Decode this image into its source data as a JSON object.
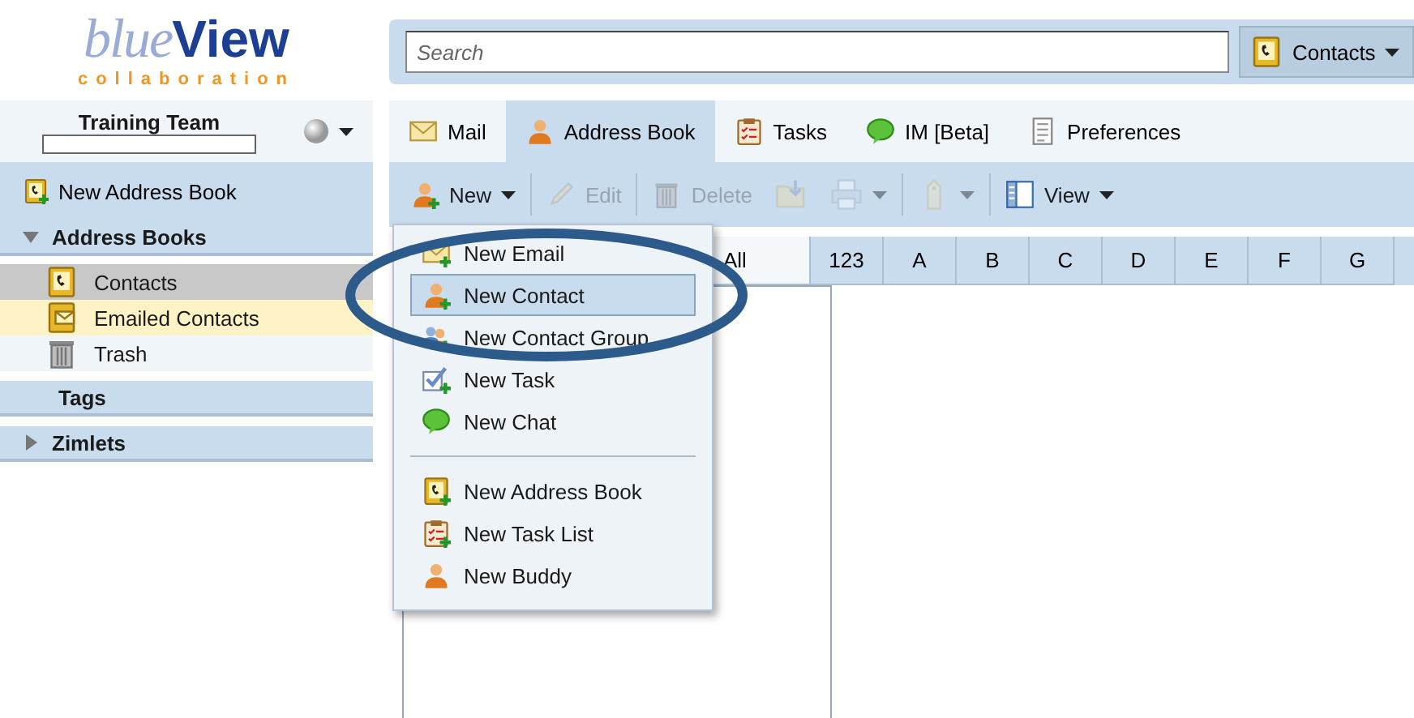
{
  "logo": {
    "word_light": "blue",
    "word_bold": "View",
    "tagline": "collaboration"
  },
  "search": {
    "placeholder": "Search"
  },
  "search_scope": {
    "label": "Contacts"
  },
  "user": {
    "name": "Training Team"
  },
  "sidebar": {
    "new_button": "New Address Book",
    "sections": [
      {
        "title": "Address Books",
        "kind": "collapsible",
        "expanded": true,
        "items": [
          {
            "label": "Contacts",
            "selected": true,
            "hovered": false
          },
          {
            "label": "Emailed Contacts",
            "selected": false,
            "hovered": true
          },
          {
            "label": "Trash",
            "selected": false,
            "hovered": false
          }
        ]
      },
      {
        "title": "Tags",
        "kind": "static"
      },
      {
        "title": "Zimlets",
        "kind": "collapsible",
        "expanded": false
      }
    ]
  },
  "tabs": [
    {
      "label": "Mail",
      "selected": false
    },
    {
      "label": "Address Book",
      "selected": true
    },
    {
      "label": "Tasks",
      "selected": false
    },
    {
      "label": "IM [Beta]",
      "selected": false
    },
    {
      "label": "Preferences",
      "selected": false
    }
  ],
  "toolbar": [
    {
      "kind": "button",
      "label": "New",
      "disabled": false,
      "menu": true
    },
    {
      "kind": "button",
      "label": "Edit",
      "disabled": true,
      "menu": false
    },
    {
      "kind": "button",
      "label": "Delete",
      "disabled": true,
      "menu": false
    },
    {
      "kind": "icon",
      "disabled": true,
      "menu": false
    },
    {
      "kind": "icon",
      "disabled": true,
      "menu": true
    },
    {
      "kind": "icon",
      "disabled": true,
      "menu": true
    },
    {
      "kind": "button",
      "label": "View",
      "disabled": false,
      "menu": true
    }
  ],
  "letters": [
    {
      "label": "All",
      "selected": true
    },
    {
      "label": "123",
      "selected": false
    },
    {
      "label": "A",
      "selected": false
    },
    {
      "label": "B",
      "selected": false
    },
    {
      "label": "C",
      "selected": false
    },
    {
      "label": "D",
      "selected": false
    },
    {
      "label": "E",
      "selected": false
    },
    {
      "label": "F",
      "selected": false
    },
    {
      "label": "G",
      "selected": false
    }
  ],
  "new_menu": {
    "groups": [
      [
        {
          "label": "New Email",
          "selected": false
        },
        {
          "label": "New Contact",
          "selected": true
        },
        {
          "label": "New Contact Group",
          "selected": false
        },
        {
          "label": "New Task",
          "selected": false
        },
        {
          "label": "New Chat",
          "selected": false
        }
      ],
      [
        {
          "label": "New Address Book",
          "selected": false
        },
        {
          "label": "New Task List",
          "selected": false
        },
        {
          "label": "New Buddy",
          "selected": false
        }
      ]
    ]
  }
}
